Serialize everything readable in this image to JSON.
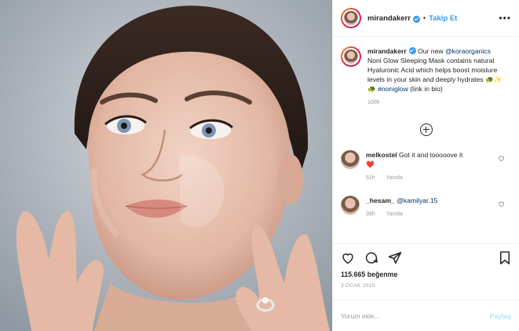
{
  "header": {
    "username": "mirandakerr",
    "separator": "•",
    "follow_label": "Takip Et",
    "more_label": "•••"
  },
  "caption": {
    "username": "mirandakerr",
    "text_1": "Our new",
    "mention": "@koraorganics",
    "text_2": "Noni Glow Sleeping Mask contains natural Hyaluronic Acid which helps boost moisture levels in your skin and deeply hydrates",
    "emoji_1": "🐢✨",
    "emoji_2": "🐢",
    "hashtag": "#noniglow",
    "text_3": "(link in bio)",
    "time": "100h"
  },
  "comments": [
    {
      "username": "melkostel",
      "text": "Got it and looooove it",
      "emoji": "❤️",
      "time": "51h",
      "reply_label": "Yanıtla"
    },
    {
      "username": "_hesam_",
      "mention": "@kamilyar.15",
      "time": "38h",
      "reply_label": "Yanıtla"
    }
  ],
  "actions": {
    "likes": "115.665 beğenme",
    "date": "3 OCAK 2019"
  },
  "add_comment": {
    "placeholder": "Yorum ekle...",
    "post_label": "Paylaş"
  },
  "colors": {
    "accent": "#3897f0",
    "post_disabled": "#b2dffc",
    "heart": "#ed4956"
  },
  "icons": [
    "verified-icon",
    "more-icon",
    "load-more-icon",
    "heart-icon",
    "comment-icon",
    "share-icon",
    "bookmark-icon"
  ]
}
